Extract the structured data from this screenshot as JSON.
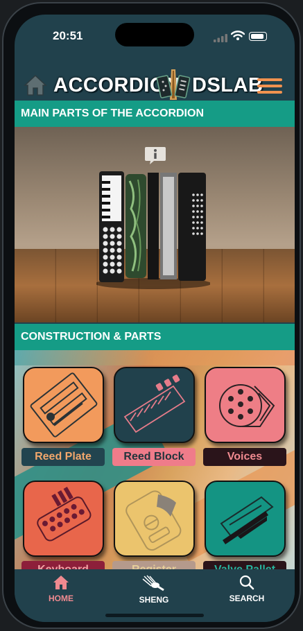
{
  "status_bar": {
    "time": "20:51"
  },
  "header": {
    "logo_left": "ACCORDION",
    "logo_right": "DSLAB"
  },
  "sections": {
    "main_parts_title": "MAIN PARTS OF THE ACCORDION",
    "construction_title": "CONSTRUCTION & PARTS"
  },
  "tiles": [
    {
      "label": "Reed Plate",
      "icon": "reed-plate-icon",
      "tile_color": "#f29a5c",
      "label_bg": "#22444f",
      "label_color": "#f2a76c"
    },
    {
      "label": "Reed Block",
      "icon": "reed-block-icon",
      "tile_color": "#21414c",
      "label_bg": "#ef7c8a",
      "label_color": "#22343c"
    },
    {
      "label": "Voices",
      "icon": "voices-icon",
      "tile_color": "#ee7e86",
      "label_bg": "#2a141a",
      "label_color": "#f08a90"
    },
    {
      "label": "Keyboard",
      "icon": "keyboard-icon",
      "tile_color": "#e8664b",
      "label_bg": "#8d1f3a",
      "label_color": "#f2a2a5"
    },
    {
      "label": "Register",
      "icon": "register-icon",
      "tile_color": "#ebc46d",
      "label_bg": "#b59a8c",
      "label_color": "#e6cf9a"
    },
    {
      "label": "Valve Pallet",
      "icon": "valve-pallet-icon",
      "tile_color": "#149483",
      "label_bg": "#2a141a",
      "label_color": "#27b39e"
    }
  ],
  "tabs": [
    {
      "label": "HOME",
      "icon": "home-icon",
      "active": true
    },
    {
      "label": "SHENG",
      "icon": "sheng-icon",
      "active": false
    },
    {
      "label": "SEARCH",
      "icon": "search-icon",
      "active": false
    }
  ],
  "colors": {
    "accent": "#159c86",
    "active_tab": "#ef8a90",
    "background": "#21414c",
    "menu": "#f2924f"
  }
}
